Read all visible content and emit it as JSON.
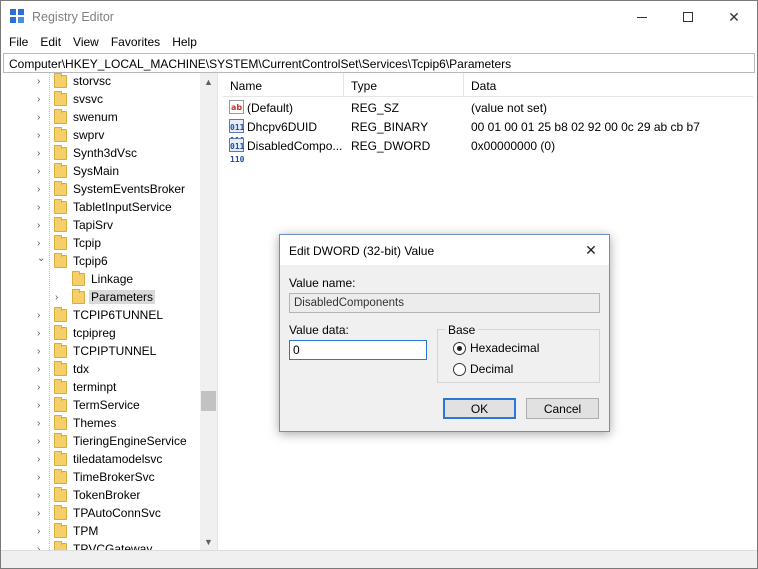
{
  "window": {
    "title": "Registry Editor",
    "close_glyph": "✕"
  },
  "menu": [
    "File",
    "Edit",
    "View",
    "Favorites",
    "Help"
  ],
  "address": "Computer\\HKEY_LOCAL_MACHINE\\SYSTEM\\CurrentControlSet\\Services\\Tcpip6\\Parameters",
  "tree": {
    "items": [
      {
        "label": "storvsc",
        "level": 0,
        "expander": "›"
      },
      {
        "label": "svsvc",
        "level": 0,
        "expander": "›"
      },
      {
        "label": "swenum",
        "level": 0,
        "expander": "›"
      },
      {
        "label": "swprv",
        "level": 0,
        "expander": "›"
      },
      {
        "label": "Synth3dVsc",
        "level": 0,
        "expander": "›"
      },
      {
        "label": "SysMain",
        "level": 0,
        "expander": "›"
      },
      {
        "label": "SystemEventsBroker",
        "level": 0,
        "expander": "›"
      },
      {
        "label": "TabletInputService",
        "level": 0,
        "expander": "›"
      },
      {
        "label": "TapiSrv",
        "level": 0,
        "expander": "›"
      },
      {
        "label": "Tcpip",
        "level": 0,
        "expander": "›"
      },
      {
        "label": "Tcpip6",
        "level": 0,
        "expander": "⌄"
      },
      {
        "label": "Linkage",
        "level": 1,
        "expander": ""
      },
      {
        "label": "Parameters",
        "level": 1,
        "expander": "›",
        "selected": true
      },
      {
        "label": "TCPIP6TUNNEL",
        "level": 0,
        "expander": "›"
      },
      {
        "label": "tcpipreg",
        "level": 0,
        "expander": "›"
      },
      {
        "label": "TCPIPTUNNEL",
        "level": 0,
        "expander": "›"
      },
      {
        "label": "tdx",
        "level": 0,
        "expander": "›"
      },
      {
        "label": "terminpt",
        "level": 0,
        "expander": "›"
      },
      {
        "label": "TermService",
        "level": 0,
        "expander": "›"
      },
      {
        "label": "Themes",
        "level": 0,
        "expander": "›"
      },
      {
        "label": "TieringEngineService",
        "level": 0,
        "expander": "›"
      },
      {
        "label": "tiledatamodelsvc",
        "level": 0,
        "expander": "›"
      },
      {
        "label": "TimeBrokerSvc",
        "level": 0,
        "expander": "›"
      },
      {
        "label": "TokenBroker",
        "level": 0,
        "expander": "›"
      },
      {
        "label": "TPAutoConnSvc",
        "level": 0,
        "expander": "›"
      },
      {
        "label": "TPM",
        "level": 0,
        "expander": "›"
      },
      {
        "label": "TPVCGateway",
        "level": 0,
        "expander": "›"
      }
    ]
  },
  "list": {
    "columns": [
      "Name",
      "Type",
      "Data"
    ],
    "rows": [
      {
        "icon": "string-value-icon",
        "icon_text": "ab",
        "name": "(Default)",
        "type": "REG_SZ",
        "data": "(value not set)"
      },
      {
        "icon": "binary-value-icon",
        "icon_text": "011\n110",
        "name": "Dhcpv6DUID",
        "type": "REG_BINARY",
        "data": "00 01 00 01 25 b8 02 92 00 0c 29 ab cb b7"
      },
      {
        "icon": "binary-value-icon",
        "icon_text": "011\n110",
        "name": "DisabledCompo...",
        "type": "REG_DWORD",
        "data": "0x00000000 (0)"
      }
    ]
  },
  "dialog": {
    "title": "Edit DWORD (32-bit) Value",
    "close_glyph": "✕",
    "value_name_label": "Value name:",
    "value_name": "DisabledComponents",
    "value_data_label": "Value data:",
    "value_data": "0",
    "base_label": "Base",
    "base_options": [
      {
        "label": "Hexadecimal",
        "checked": true
      },
      {
        "label": "Decimal",
        "checked": false
      }
    ],
    "ok_label": "OK",
    "cancel_label": "Cancel"
  }
}
